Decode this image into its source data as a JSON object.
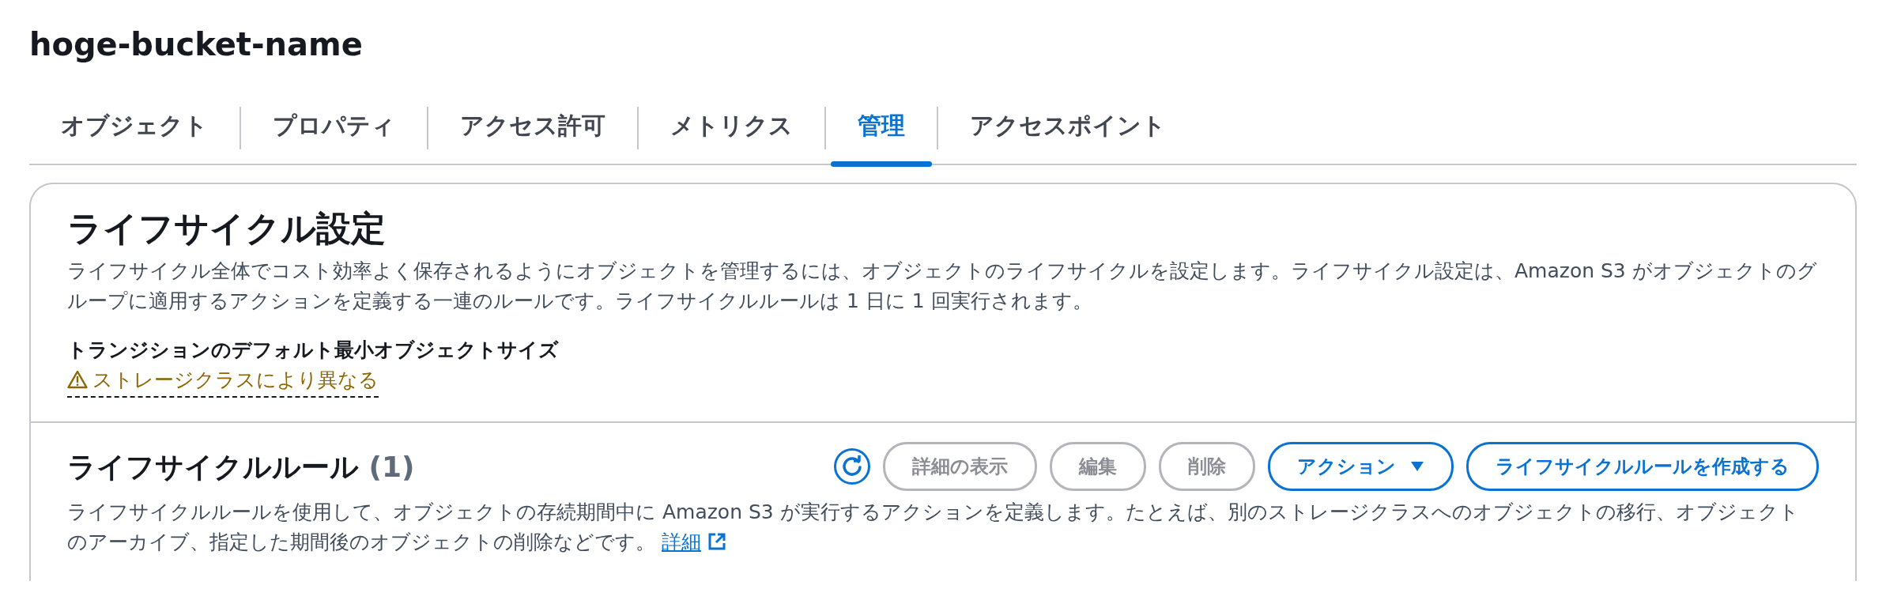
{
  "page_title": "hoge-bucket-name",
  "tabs": [
    {
      "label": "オブジェクト",
      "selected": false
    },
    {
      "label": "プロパティ",
      "selected": false
    },
    {
      "label": "アクセス許可",
      "selected": false
    },
    {
      "label": "メトリクス",
      "selected": false
    },
    {
      "label": "管理",
      "selected": true
    },
    {
      "label": "アクセスポイント",
      "selected": false
    }
  ],
  "lifecycle_config": {
    "title": "ライフサイクル設定",
    "description": "ライフサイクル全体でコスト効率よく保存されるようにオブジェクトを管理するには、オブジェクトのライフサイクルを設定します。ライフサイクル設定は、Amazon S3 がオブジェクトのグループに適用するアクションを定義する一連のルールです。ライフサイクルルールは 1 日に 1 回実行されます。",
    "field_label": "トランジションのデフォルト最小オブジェクトサイズ",
    "field_value": "ストレージクラスにより異なる"
  },
  "lifecycle_rules": {
    "title": "ライフサイクルルール",
    "count": "(1)",
    "buttons": [
      {
        "kind": "refresh",
        "disabled": false
      },
      {
        "kind": "text",
        "label": "詳細の表示",
        "disabled": true
      },
      {
        "kind": "text",
        "label": "編集",
        "disabled": true
      },
      {
        "kind": "text",
        "label": "削除",
        "disabled": true
      },
      {
        "kind": "dropdown",
        "label": "アクション",
        "disabled": false
      },
      {
        "kind": "text",
        "label": "ライフサイクルルールを作成する",
        "disabled": false
      }
    ],
    "description": "ライフサイクルルールを使用して、オブジェクトの存続期間中に Amazon S3 が実行するアクションを定義します。たとえば、別のストレージクラスへのオブジェクトの移行、オブジェクトのアーカイブ、指定した期間後のオブジェクトの削除などです。",
    "link": "詳細"
  }
}
